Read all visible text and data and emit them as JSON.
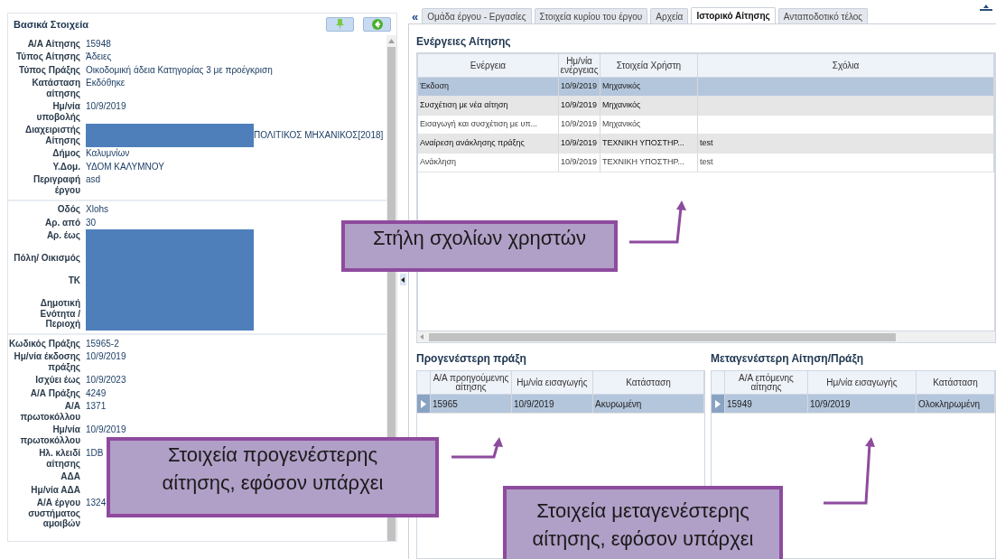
{
  "details_panel": {
    "title": "Βασικά Στοιχεία",
    "sections": [
      {
        "fields": [
          {
            "label": "Α/Α Αίτησης",
            "value": "15948"
          },
          {
            "label": "Τύπος Αίτησης",
            "value": "Άδειες"
          },
          {
            "label": "Τύπος Πράξης",
            "value": "Οικοδομική άδεια Κατηγορίας 3 με προέγκριση"
          },
          {
            "label": "Κατάσταση αίτησης",
            "value": "Εκδόθηκε"
          },
          {
            "label": "Ημ/νία υποβολής",
            "value": "10/9/2019"
          },
          {
            "label": "Διαχειριστής Αίτησης",
            "value": "ΠΟΛΙΤΙΚΟΣ ΜΗΧΑΝΙΚΟΣ[2018]",
            "redacted": true
          },
          {
            "label": "Δήμος",
            "value": "Καλυμνίων"
          },
          {
            "label": "Υ.Δομ.",
            "value": "ΥΔΟΜ ΚΑΛΥΜΝΟΥ"
          },
          {
            "label": "Περιγραφή έργου",
            "value": "asd"
          }
        ]
      },
      {
        "fields": [
          {
            "label": "Οδός",
            "value": "Xlohs"
          },
          {
            "label": "Αρ. από",
            "value": "30"
          },
          {
            "label": "Αρ. έως",
            "redacted": true
          },
          {
            "label": "Πόλη/ Οικισμός",
            "redacted": true
          },
          {
            "label": "ΤΚ",
            "redacted": true
          },
          {
            "label": "Δημοτική Ενότητα / Περιοχή",
            "redacted": true
          }
        ]
      },
      {
        "fields": [
          {
            "label": "Κωδικός Πράξης",
            "value": "15965-2"
          },
          {
            "label": "Ημ/νία έκδοσης πράξης",
            "value": "10/9/2019"
          },
          {
            "label": "Ισχύει έως",
            "value": "10/9/2023"
          },
          {
            "label": "Α/Α Πράξης",
            "value": "4249"
          },
          {
            "label": "Α/Α πρωτοκόλλου",
            "value": "1371"
          },
          {
            "label": "Ημ/νία πρωτοκόλλου",
            "value": "10/9/2019"
          },
          {
            "label": "Ηλ. κλειδί αίτησης",
            "value": "1DB"
          },
          {
            "label": "ΑΔΑ"
          },
          {
            "label": "Ημ/νία ΑΔΑ"
          },
          {
            "label": "Α/Α έργου συστήματος αμοιβών",
            "value": "1324"
          }
        ]
      }
    ]
  },
  "tabs": [
    {
      "label": "Ομάδα έργου - Εργασίες",
      "selected": false
    },
    {
      "label": "Στοιχεία κυρίου του έργου",
      "selected": false
    },
    {
      "label": "Αρχεία",
      "selected": false
    },
    {
      "label": "Ιστορικό Αίτησης",
      "selected": true
    },
    {
      "label": "Ανταποδοτικό τέλος",
      "selected": false
    }
  ],
  "collapse_label": "«",
  "actions": {
    "title": "Ενέργειες Αίτησης",
    "columns": [
      "Ενέργεια",
      "Ημ/νία ενέργειας",
      "Στοιχεία Χρήστη",
      "Σχόλια"
    ],
    "rows": [
      {
        "cells": [
          "Έκδοση",
          "10/9/2019",
          "Μηχανικός",
          ""
        ],
        "selected": true
      },
      {
        "cells": [
          "Συσχέτιση με νέα αίτηση",
          "10/9/2019",
          "Μηχανικός",
          ""
        ],
        "selected": false
      },
      {
        "cells": [
          "Εισαγωγή και συσχέτιση με υπ...",
          "10/9/2019",
          "Μηχανικός",
          ""
        ],
        "selected": false
      },
      {
        "cells": [
          "Αναίρεση ανάκλησης πράξης",
          "10/9/2019",
          "ΤΕΧΝΙΚΗ ΥΠΟΣΤΗΡ...",
          "test"
        ],
        "selected": false
      },
      {
        "cells": [
          "Ανάκληση",
          "10/9/2019",
          "ΤΕΧΝΙΚΗ ΥΠΟΣΤΗΡ...",
          "test"
        ],
        "selected": false
      }
    ]
  },
  "previous": {
    "title": "Προγενέστερη πράξη",
    "columns": [
      "Α/Α προηγούμενης αίτησης",
      "Ημ/νία εισαγωγής",
      "Κατάσταση"
    ],
    "rows": [
      {
        "cells": [
          "15965",
          "10/9/2019",
          "Ακυρωμένη"
        ],
        "selected": true
      }
    ]
  },
  "next": {
    "title": "Μεταγενέστερη Αίτηση/Πράξη",
    "columns": [
      "Α/Α επόμενης αίτησης",
      "Ημ/νία εισαγωγής",
      "Κατάσταση"
    ],
    "rows": [
      {
        "cells": [
          "15949",
          "10/9/2019",
          "Ολοκληρωμένη"
        ],
        "selected": true
      }
    ]
  },
  "annotations": [
    {
      "lines": [
        "Στήλη σχολίων χρηστών"
      ]
    },
    {
      "lines": [
        "Στοιχεία προγενέστερης",
        "αίτησης, εφόσον υπάρχει"
      ]
    },
    {
      "lines": [
        "Στοιχεία μεταγενέστερης",
        "αίτησης, εφόσον υπάρχει"
      ]
    }
  ]
}
